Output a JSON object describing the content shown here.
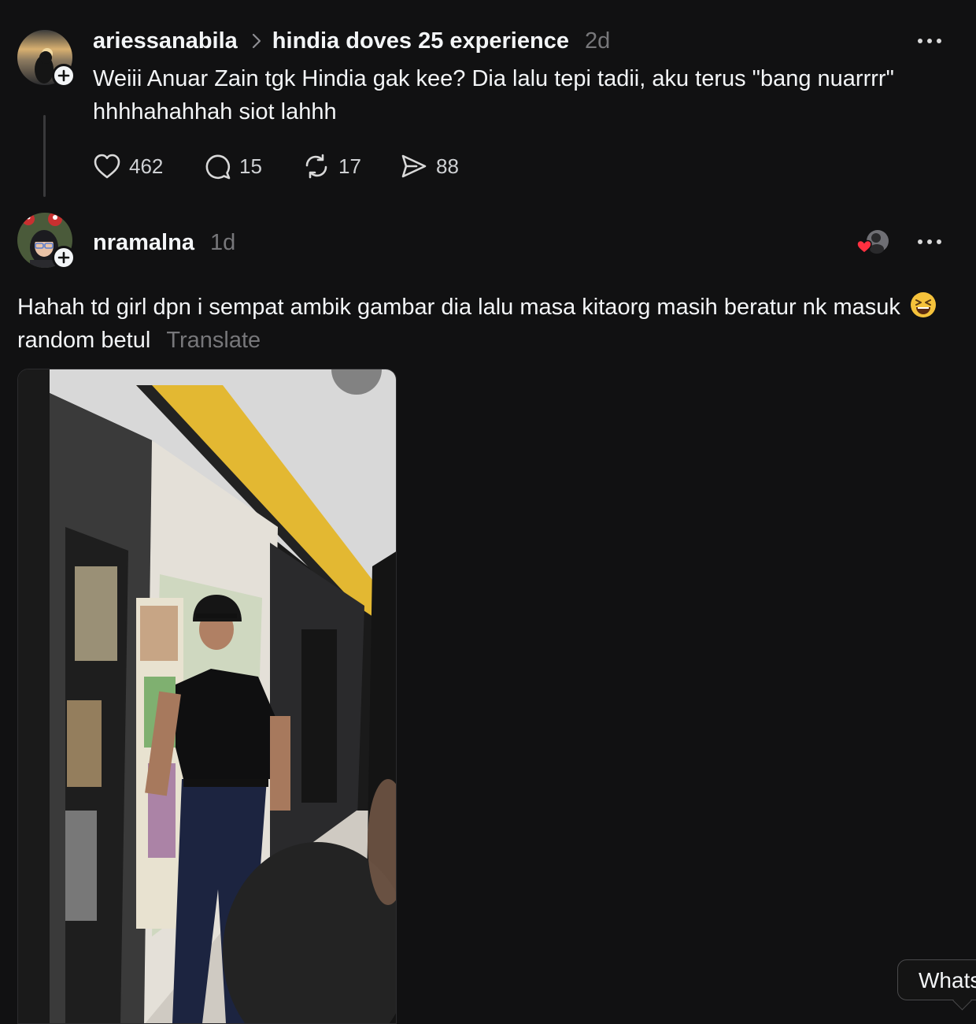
{
  "post1": {
    "username": "ariessanabila",
    "community": "hindia doves 25 experience",
    "time": "2d",
    "text": "Weiii Anuar Zain tgk Hindia gak kee? Dia lalu tepi tadii, aku terus \"bang nuarrrr\" hhhhahahhah siot lahhh",
    "likes": "462",
    "replies": "15",
    "reposts": "17",
    "shares": "88"
  },
  "post2": {
    "username": "nramalna",
    "time": "1d",
    "text_part1": "Hahah td girl dpn i sempat ambik gambar dia lalu masa kitaorg masih beratur nk masuk",
    "emoji": "😆",
    "text_part2": "random betul",
    "translate": "Translate"
  },
  "tooltip": {
    "text": "Whats"
  },
  "colors": {
    "background": "#111112",
    "text": "#f3f5f7",
    "muted": "#77777a",
    "heart": "#ff3040"
  }
}
